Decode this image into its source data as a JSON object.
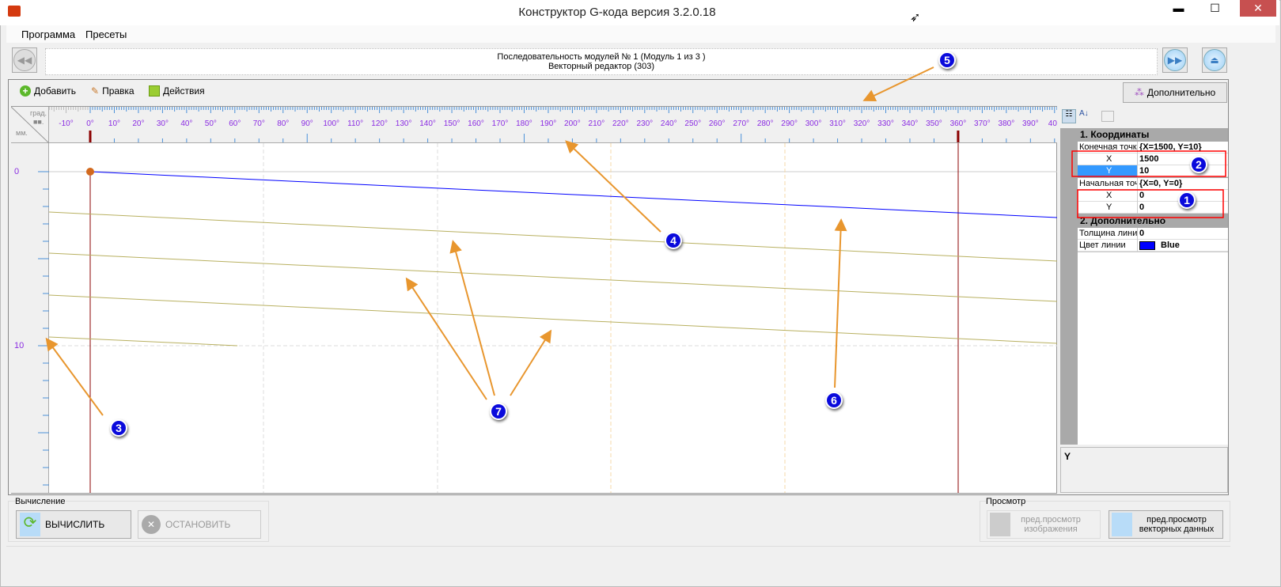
{
  "window": {
    "title": "Конструктор G-кода версия 3.2.0.18",
    "minimize": "▬",
    "maximize": "☐",
    "close": "✕"
  },
  "menu": {
    "items": [
      "Программа",
      "Пресеты"
    ]
  },
  "nav": {
    "line1": "Последовательность модулей № 1 (Модуль 1 из 3 )",
    "line2": "Векторный редактор (303)"
  },
  "toolbar": {
    "add": "Добавить",
    "edit": "Правка",
    "actions": "Действия",
    "more": "Дополнительно"
  },
  "ruler": {
    "corner_top": "град.",
    "corner_mid": "■■.",
    "corner_bottom": "мм.",
    "labels": [
      "-10°",
      "0°",
      "10°",
      "20°",
      "30°",
      "40°",
      "50°",
      "60°",
      "70°",
      "80°",
      "90°",
      "100°",
      "110°",
      "120°",
      "130°",
      "140°",
      "150°",
      "160°",
      "170°",
      "180°",
      "190°",
      "200°",
      "210°",
      "220°",
      "230°",
      "240°",
      "250°",
      "260°",
      "270°",
      "280°",
      "290°",
      "300°",
      "310°",
      "320°",
      "330°",
      "340°",
      "350°",
      "360°",
      "370°",
      "380°",
      "390°",
      "40"
    ],
    "left_labels": [
      "0",
      "10"
    ]
  },
  "properties": {
    "cat1": "1. Координаты",
    "end_point": {
      "name": "Конечная точка",
      "value": "{X=1500, Y=10}",
      "x_label": "X",
      "x": "1500",
      "y_label": "Y",
      "y": "10"
    },
    "start_point": {
      "name": "Начальная точка",
      "value": "{X=0, Y=0}",
      "x_label": "X",
      "x": "0",
      "y_label": "Y",
      "y": "0"
    },
    "cat2": "2. Дополнительно",
    "thickness": {
      "name": "Толщина линии",
      "value": "0"
    },
    "color": {
      "name": "Цвет линии",
      "value": "Blue",
      "swatch": "#0000ff"
    },
    "description": "Y"
  },
  "bottom": {
    "calc_group": "Вычисление",
    "calc": "ВЫЧИСЛИТЬ",
    "stop": "ОСТАНОВИТЬ",
    "view_group": "Просмотр",
    "preview_image": "пред.просмотр изображения",
    "preview_vector": "пред.просмотр векторных данных"
  },
  "annotations": [
    "1",
    "2",
    "3",
    "4",
    "5",
    "6",
    "7"
  ],
  "colors": {
    "accent": "#0a0adc",
    "arrow": "#e8962e",
    "blue_line": "#0000ff",
    "olive_line": "#b8b060",
    "marker": "#8b0000"
  }
}
